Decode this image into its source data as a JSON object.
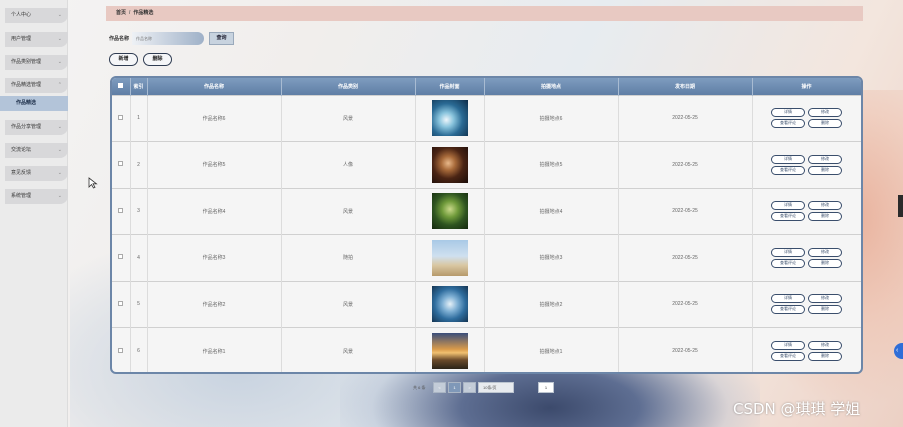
{
  "sidebar": {
    "items": [
      {
        "label": "个人中心"
      },
      {
        "label": "用户管理"
      },
      {
        "label": "作品类别管理"
      },
      {
        "label": "作品精选管理"
      },
      {
        "label": "作品分享管理"
      },
      {
        "label": "交流论坛"
      },
      {
        "label": "意见反馈"
      },
      {
        "label": "系统管理"
      }
    ],
    "submenu_label": "作品精选"
  },
  "breadcrumb": {
    "home": "首页",
    "current": "作品精选"
  },
  "search": {
    "label": "作品名称",
    "placeholder": "作品名称",
    "button": "查询"
  },
  "actions": {
    "add": "新增",
    "delete": "删除"
  },
  "table": {
    "headers": [
      "索引",
      "作品名称",
      "作品类别",
      "作品封面",
      "拍摄地点",
      "发布日期",
      "操作"
    ],
    "rows": [
      {
        "index": "1",
        "name": "作品名称6",
        "category": "风景",
        "location": "拍摄地点6",
        "date": "2022-05-25"
      },
      {
        "index": "2",
        "name": "作品名称5",
        "category": "人像",
        "location": "拍摄地点5",
        "date": "2022-05-25"
      },
      {
        "index": "3",
        "name": "作品名称4",
        "category": "风景",
        "location": "拍摄地点4",
        "date": "2022-05-25"
      },
      {
        "index": "4",
        "name": "作品名称3",
        "category": "随拍",
        "location": "拍摄地点3",
        "date": "2022-05-25"
      },
      {
        "index": "5",
        "name": "作品名称2",
        "category": "风景",
        "location": "拍摄地点2",
        "date": "2022-05-25"
      },
      {
        "index": "6",
        "name": "作品名称1",
        "category": "风景",
        "location": "拍摄地点1",
        "date": "2022-05-25"
      }
    ],
    "ops": {
      "detail": "详情",
      "edit": "修改",
      "comments": "查看评论",
      "delete": "删除"
    }
  },
  "pagination": {
    "total": "共 6 条",
    "prev": "<",
    "page": "1",
    "next": ">",
    "page_size": "10条/页",
    "jump": "1"
  },
  "watermark": "CSDN @琪琪 学姐",
  "colors": {
    "accent": "#6c86a8",
    "header": "#5f7ea5",
    "breadcrumb_bg": "#e8c9c2",
    "sidebar_active": "#b3c4d9"
  }
}
